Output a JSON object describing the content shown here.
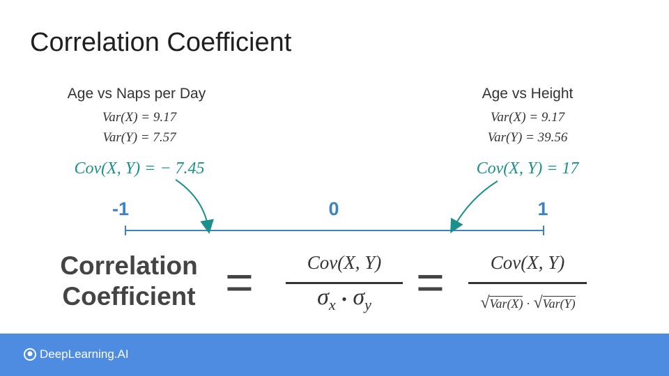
{
  "title": "Correlation Coefficient",
  "left_example": {
    "heading": "Age vs Naps per Day",
    "var_x": "Var(X) = 9.17",
    "var_y": "Var(Y) = 7.57",
    "cov": "Cov(X, Y) = − 7.45"
  },
  "right_example": {
    "heading": "Age vs Height",
    "var_x": "Var(X) = 9.17",
    "var_y": "Var(Y) = 39.56",
    "cov": "Cov(X, Y) = 17"
  },
  "scale": {
    "min_label": "-1",
    "mid_label": "0",
    "max_label": "1",
    "color": "#3d82c4"
  },
  "formula": {
    "lhs_line1": "Correlation",
    "lhs_line2": "Coefficient",
    "equals": "=",
    "numerator": "Cov(X, Y)",
    "sigma": "σ",
    "sub_x": "x",
    "sub_y": "y",
    "dot": "•",
    "cdot": "·",
    "var_x": "Var(X)",
    "var_y": "Var(Y)"
  },
  "colors": {
    "accent_teal": "#1a8f8c",
    "footer": "#4d8ce0"
  },
  "footer": {
    "logo_icon": "deeplearning-logo-icon",
    "brand": "DeepLearning.AI"
  }
}
